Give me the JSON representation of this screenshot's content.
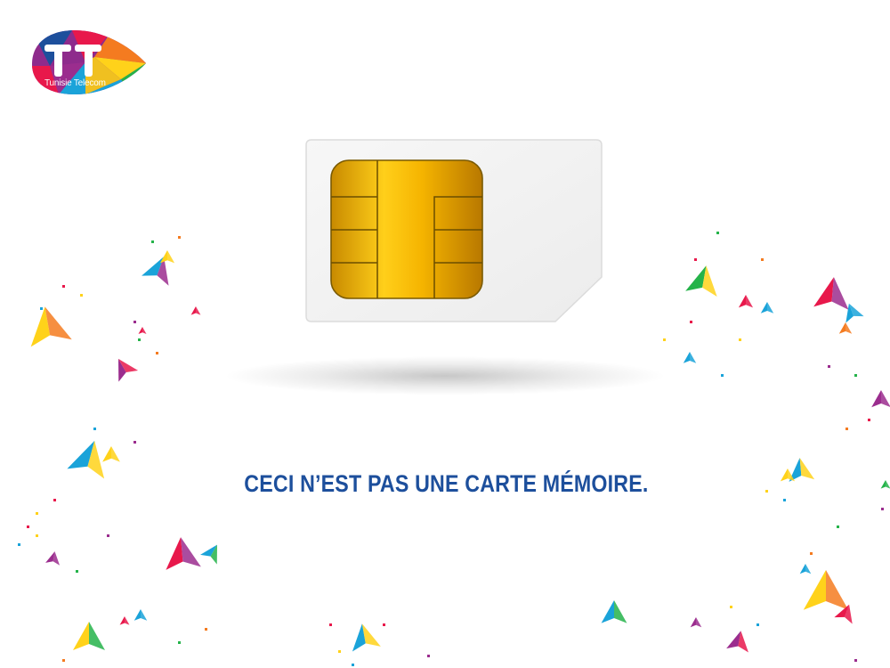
{
  "brand": {
    "logo_letters": "TT",
    "logo_name": "Tunisie Telecom"
  },
  "slogan": "CECI N’EST PAS UNE CARTE MÉMOIRE.",
  "colors": {
    "slogan": "#1d4f9c",
    "chip_gold": "#f0b000",
    "sim_white": "#f4f4f4",
    "confetti": [
      "#e8184b",
      "#ffd21a",
      "#1aa3d9",
      "#9b2d8e",
      "#25b34a",
      "#f47b20"
    ]
  },
  "icons": {
    "logo": "tunisie-telecom-logo-icon",
    "sim": "sim-card-icon",
    "chip": "sim-chip-icon",
    "decor": "confetti-triangle-icon"
  }
}
